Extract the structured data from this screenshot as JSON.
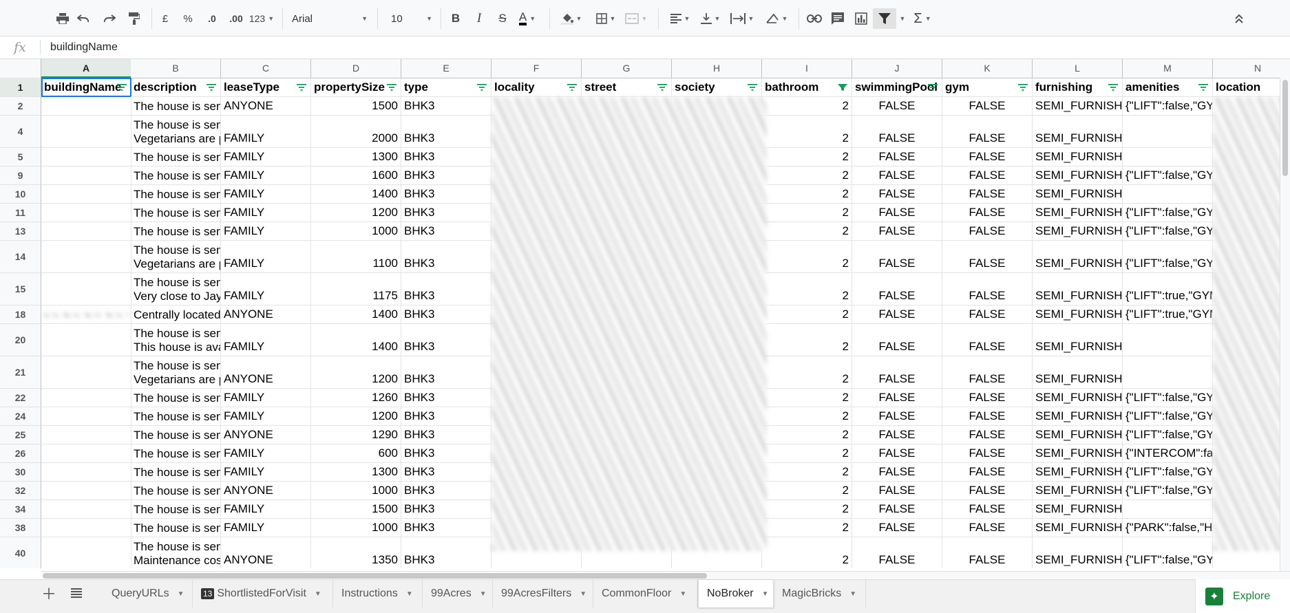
{
  "toolbar": {
    "currency": "£",
    "percent": "%",
    "dec_decrease": ".0",
    "dec_increase": ".00",
    "more_formats": "123",
    "font_name": "Arial",
    "font_size": "10",
    "bold": "B",
    "italic": "I",
    "strike": "S",
    "text_color": "A",
    "functions": "Σ"
  },
  "formula_bar": {
    "fx": "fx",
    "value": "buildingName"
  },
  "column_letters": [
    "A",
    "B",
    "C",
    "D",
    "E",
    "F",
    "G",
    "H",
    "I",
    "J",
    "K",
    "L",
    "M",
    "N"
  ],
  "headers": [
    "buildingName",
    "description",
    "leaseType",
    "propertySize",
    "type",
    "locality",
    "street",
    "society",
    "bathroom",
    "swimmingPool",
    "gym",
    "furnishing",
    "amenities",
    "location"
  ],
  "rows": [
    {
      "num": "2",
      "desc": [
        "The house is semi"
      ],
      "lease": "ANYONE",
      "size": "1500",
      "type": "BHK3",
      "bath": "2",
      "pool": "FALSE",
      "gym": "FALSE",
      "furn": "SEMI_FURNISHED",
      "amen": "{\"LIFT\":false,\"GYM\""
    },
    {
      "num": "4",
      "desc": [
        "The house is semi",
        "Vegetarians are p"
      ],
      "lease": "FAMILY",
      "size": "2000",
      "type": "BHK3",
      "bath": "2",
      "pool": "FALSE",
      "gym": "FALSE",
      "furn": "SEMI_FURNISHED",
      "amen": ""
    },
    {
      "num": "5",
      "desc": [
        "The house is semi"
      ],
      "lease": "FAMILY",
      "size": "1300",
      "type": "BHK3",
      "bath": "2",
      "pool": "FALSE",
      "gym": "FALSE",
      "furn": "SEMI_FURNISHED",
      "amen": ""
    },
    {
      "num": "9",
      "desc": [
        "The house is semi"
      ],
      "lease": "FAMILY",
      "size": "1600",
      "type": "BHK3",
      "bath": "2",
      "pool": "FALSE",
      "gym": "FALSE",
      "furn": "SEMI_FURNISHED",
      "amen": "{\"LIFT\":false,\"GYM\""
    },
    {
      "num": "10",
      "desc": [
        "The house is semi"
      ],
      "lease": "FAMILY",
      "size": "1400",
      "type": "BHK3",
      "bath": "2",
      "pool": "FALSE",
      "gym": "FALSE",
      "furn": "SEMI_FURNISHED",
      "amen": ""
    },
    {
      "num": "11",
      "desc": [
        "The house is semi"
      ],
      "lease": "FAMILY",
      "size": "1200",
      "type": "BHK3",
      "bath": "2",
      "pool": "FALSE",
      "gym": "FALSE",
      "furn": "SEMI_FURNISHED",
      "amen": "{\"LIFT\":false,\"GYM\""
    },
    {
      "num": "13",
      "desc": [
        "The house is semi"
      ],
      "lease": "FAMILY",
      "size": "1000",
      "type": "BHK3",
      "bath": "2",
      "pool": "FALSE",
      "gym": "FALSE",
      "furn": "SEMI_FURNISHED",
      "amen": "{\"LIFT\":false,\"GYM\""
    },
    {
      "num": "14",
      "desc": [
        "The house is semi",
        "Vegetarians are p"
      ],
      "lease": "FAMILY",
      "size": "1100",
      "type": "BHK3",
      "bath": "2",
      "pool": "FALSE",
      "gym": "FALSE",
      "furn": "SEMI_FURNISHED",
      "amen": "{\"LIFT\":false,\"GYM\""
    },
    {
      "num": "15",
      "desc": [
        "The house is semi",
        "Very close to Jay"
      ],
      "lease": "FAMILY",
      "size": "1175",
      "type": "BHK3",
      "bath": "2",
      "pool": "FALSE",
      "gym": "FALSE",
      "furn": "SEMI_FURNISHED",
      "amen": "{\"LIFT\":true,\"GYM\""
    },
    {
      "num": "18",
      "desc": [
        "Centrally located"
      ],
      "lease": "ANYONE",
      "size": "1400",
      "type": "BHK3",
      "bath": "2",
      "pool": "FALSE",
      "gym": "FALSE",
      "furn": "SEMI_FURNISHED",
      "amen": "{\"LIFT\":true,\"GYM\""
    },
    {
      "num": "20",
      "desc": [
        "The house is semi",
        "This house is ava"
      ],
      "lease": "FAMILY",
      "size": "1400",
      "type": "BHK3",
      "bath": "2",
      "pool": "FALSE",
      "gym": "FALSE",
      "furn": "SEMI_FURNISHED",
      "amen": ""
    },
    {
      "num": "21",
      "desc": [
        "The house is semi",
        "Vegetarians are p"
      ],
      "lease": "ANYONE",
      "size": "1200",
      "type": "BHK3",
      "bath": "2",
      "pool": "FALSE",
      "gym": "FALSE",
      "furn": "SEMI_FURNISHED",
      "amen": ""
    },
    {
      "num": "22",
      "desc": [
        "The house is semi"
      ],
      "lease": "FAMILY",
      "size": "1260",
      "type": "BHK3",
      "bath": "2",
      "pool": "FALSE",
      "gym": "FALSE",
      "furn": "SEMI_FURNISHED",
      "amen": "{\"LIFT\":false,\"GYM\""
    },
    {
      "num": "24",
      "desc": [
        "The house is semi"
      ],
      "lease": "FAMILY",
      "size": "1200",
      "type": "BHK3",
      "bath": "2",
      "pool": "FALSE",
      "gym": "FALSE",
      "furn": "SEMI_FURNISHED",
      "amen": "{\"LIFT\":false,\"GYM\""
    },
    {
      "num": "25",
      "desc": [
        "The house is semi"
      ],
      "lease": "ANYONE",
      "size": "1290",
      "type": "BHK3",
      "bath": "2",
      "pool": "FALSE",
      "gym": "FALSE",
      "furn": "SEMI_FURNISHED",
      "amen": "{\"LIFT\":false,\"GYM\""
    },
    {
      "num": "26",
      "desc": [
        "The house is semi"
      ],
      "lease": "FAMILY",
      "size": "600",
      "type": "BHK3",
      "bath": "2",
      "pool": "FALSE",
      "gym": "FALSE",
      "furn": "SEMI_FURNISHED",
      "amen": "{\"INTERCOM\":false"
    },
    {
      "num": "30",
      "desc": [
        "The house is semi"
      ],
      "lease": "FAMILY",
      "size": "1300",
      "type": "BHK3",
      "bath": "2",
      "pool": "FALSE",
      "gym": "FALSE",
      "furn": "SEMI_FURNISHED",
      "amen": "{\"LIFT\":false,\"GYM\""
    },
    {
      "num": "32",
      "desc": [
        "The house is semi"
      ],
      "lease": "ANYONE",
      "size": "1000",
      "type": "BHK3",
      "bath": "2",
      "pool": "FALSE",
      "gym": "FALSE",
      "furn": "SEMI_FURNISHED",
      "amen": "{\"LIFT\":false,\"GYM\""
    },
    {
      "num": "34",
      "desc": [
        "The house is semi"
      ],
      "lease": "FAMILY",
      "size": "1500",
      "type": "BHK3",
      "bath": "2",
      "pool": "FALSE",
      "gym": "FALSE",
      "furn": "SEMI_FURNISHED",
      "amen": ""
    },
    {
      "num": "38",
      "desc": [
        "The house is semi"
      ],
      "lease": "FAMILY",
      "size": "1000",
      "type": "BHK3",
      "bath": "2",
      "pool": "FALSE",
      "gym": "FALSE",
      "furn": "SEMI_FURNISHED",
      "amen": "{\"PARK\":false,\"HOU"
    },
    {
      "num": "40",
      "desc": [
        "The house is semi",
        "Maintenance cost"
      ],
      "lease": "ANYONE",
      "size": "1350",
      "type": "BHK3",
      "bath": "2",
      "pool": "FALSE",
      "gym": "FALSE",
      "furn": "SEMI_FURNISHED",
      "amen": "{\"LIFT\":false,\"GYM\""
    }
  ],
  "tabs": [
    {
      "label": "QueryURLs",
      "badge": ""
    },
    {
      "label": "ShortlistedForVisit",
      "badge": "13"
    },
    {
      "label": "Instructions",
      "badge": ""
    },
    {
      "label": "99Acres",
      "badge": ""
    },
    {
      "label": "99AcresFilters",
      "badge": ""
    },
    {
      "label": "CommonFloor",
      "badge": ""
    },
    {
      "label": "NoBroker",
      "badge": "",
      "active": true
    },
    {
      "label": "MagicBricks",
      "badge": ""
    }
  ],
  "explore_label": "Explore",
  "colors": {
    "accent_green": "#0f9d58",
    "selection_blue": "#1a73e8",
    "header_bg": "#f8f9fa",
    "selected_header_bg": "#e2ebe5"
  }
}
